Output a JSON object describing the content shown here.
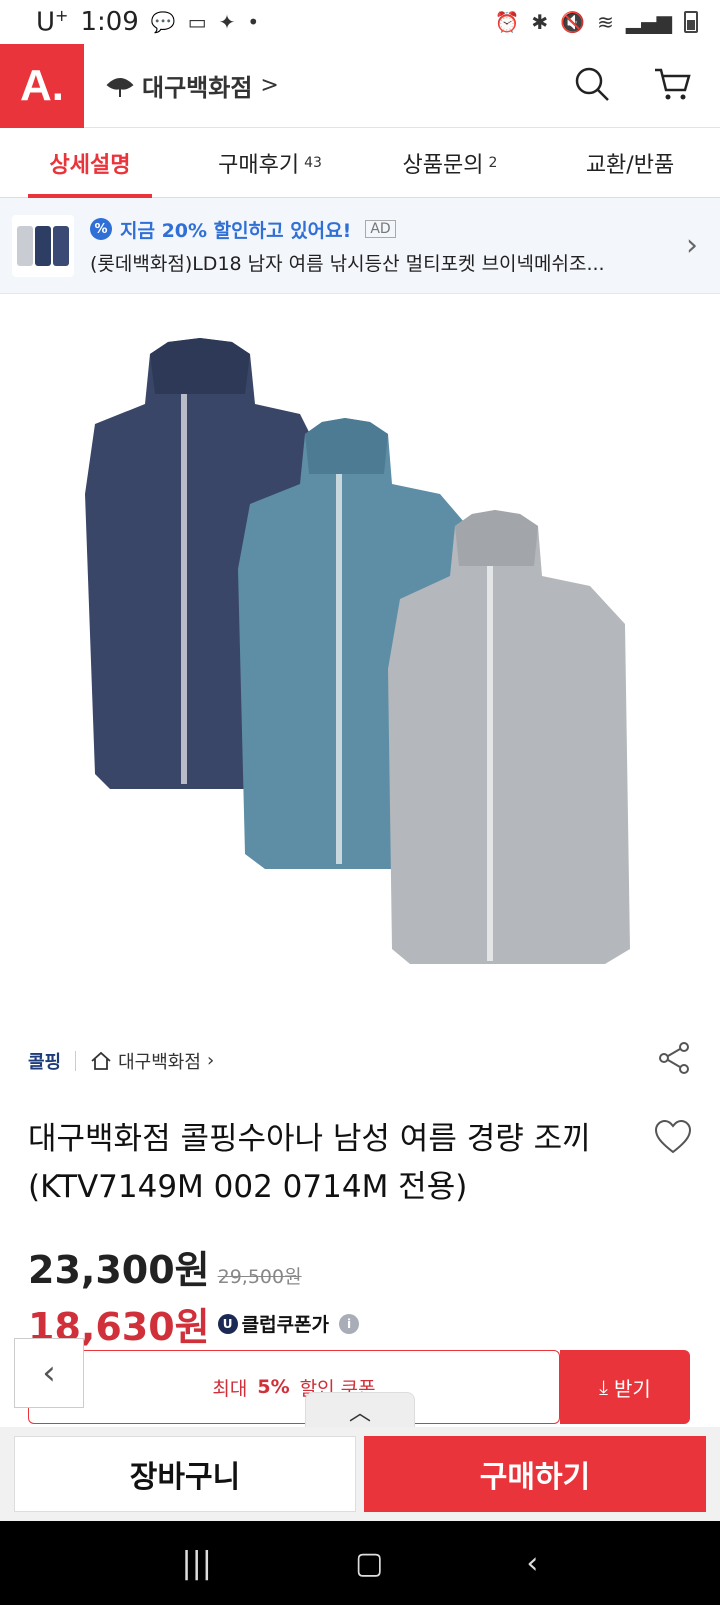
{
  "status": {
    "carrier": "U",
    "carrier_sup": "+",
    "time": "1:09"
  },
  "header": {
    "logo": "A.",
    "store_name": "대구백화점",
    "store_chevron": ">"
  },
  "tabs": [
    {
      "label": "상세설명",
      "count": ""
    },
    {
      "label": "구매후기",
      "count": "43"
    },
    {
      "label": "상품문의",
      "count": "2"
    },
    {
      "label": "교환/반품",
      "count": ""
    }
  ],
  "ad": {
    "headline": "지금 20% 할인하고 있어요!",
    "badge": "AD",
    "product": "(롯데백화점)LD18 남자 여름 낚시등산 멀티포켓 브이넥메쉬조..."
  },
  "product": {
    "brand": "콜핑",
    "shop": "대구백화점",
    "title": "대구백화점 콜핑수아나 남성 여름 경량 조끼(KTV7149M  002 0714M 전용)",
    "price": "23,300원",
    "original_price": "29,500원",
    "club_price": "18,630원",
    "club_label": "클럽쿠폰가",
    "club_icon": "U"
  },
  "coupon": {
    "prefix": "최대",
    "percent": "5%",
    "suffix": "할인 쿠폰",
    "button": "받기"
  },
  "actions": {
    "cart": "장바구니",
    "buy": "구매하기"
  },
  "colors": {
    "accent": "#e8343a",
    "brand_navy": "#1e3b7a",
    "ad_blue": "#2f6fd6"
  }
}
